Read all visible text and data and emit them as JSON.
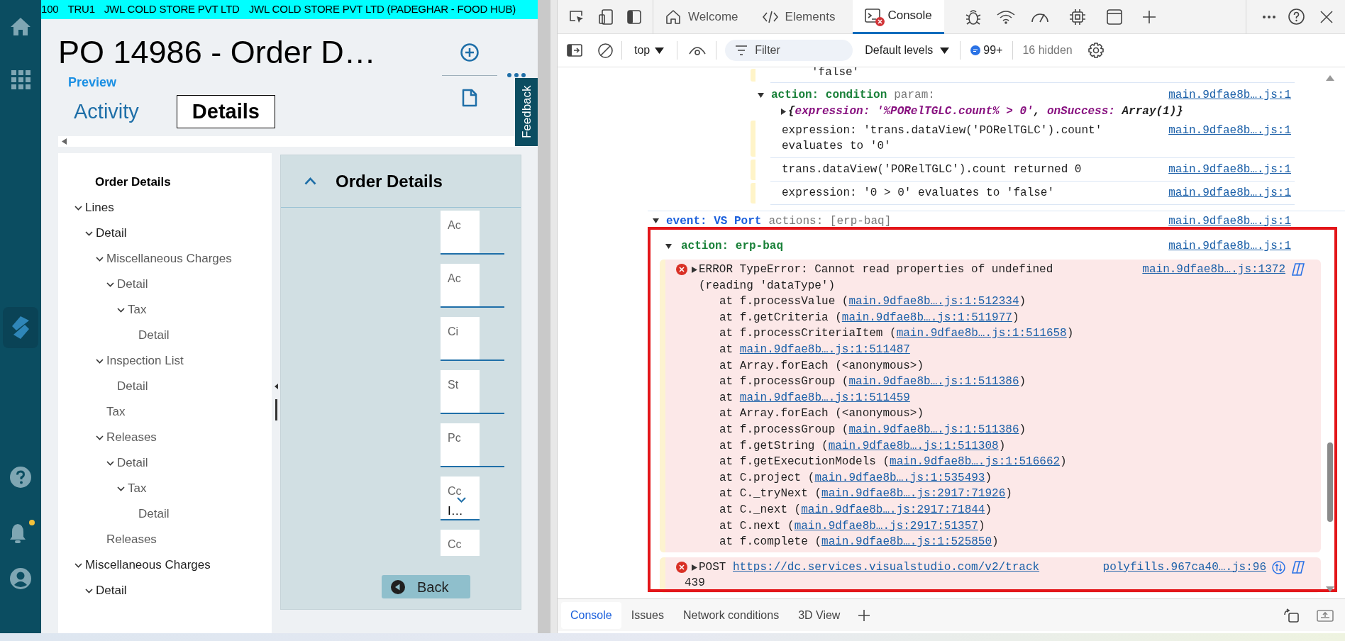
{
  "app": {
    "context_bar": [
      "100",
      "TRU1",
      "JWL COLD STORE PVT LTD",
      "JWL COLD STORE PVT LTD (PADEGHAR - FOOD HUB)"
    ],
    "title": "PO 14986 - Order D…",
    "preview_link": "Preview",
    "tabs": [
      {
        "label": "Activity",
        "selected": false
      },
      {
        "label": "Details",
        "selected": true
      }
    ],
    "feedback_tab": "Feedback",
    "notifications_unread": true,
    "tree": {
      "heading": "Order Details",
      "items": [
        {
          "label": "Lines",
          "expanded": true,
          "children": [
            {
              "label": "Detail",
              "expanded": true,
              "children": [
                {
                  "label": "Miscellaneous Charges",
                  "expanded": true,
                  "children": [
                    {
                      "label": "Detail",
                      "expanded": true,
                      "children": [
                        {
                          "label": "Tax",
                          "expanded": true,
                          "children": [
                            {
                              "label": "Detail"
                            }
                          ]
                        }
                      ]
                    }
                  ]
                },
                {
                  "label": "Inspection List",
                  "expanded": true,
                  "children": [
                    {
                      "label": "Detail"
                    }
                  ]
                },
                {
                  "label": "Tax"
                },
                {
                  "label": "Releases",
                  "expanded": true,
                  "children": [
                    {
                      "label": "Detail",
                      "expanded": true,
                      "children": [
                        {
                          "label": "Tax",
                          "expanded": true,
                          "children": [
                            {
                              "label": "Detail"
                            }
                          ]
                        }
                      ]
                    }
                  ]
                },
                {
                  "label": "Releases"
                }
              ]
            }
          ]
        },
        {
          "label": "Miscellaneous Charges",
          "expanded": true,
          "children": [
            {
              "label": "Detail",
              "expanded": true
            }
          ]
        }
      ]
    },
    "panel": {
      "title": "Order Details",
      "expanded": true,
      "fields": [
        {
          "kind": "text",
          "label": "Ac"
        },
        {
          "kind": "text",
          "label": "Ac"
        },
        {
          "kind": "text",
          "label": "Ci"
        },
        {
          "kind": "text",
          "label": "St"
        },
        {
          "kind": "text",
          "label": "Pc"
        },
        {
          "kind": "dropdown",
          "label": "Cc",
          "value": "I…"
        },
        {
          "kind": "text",
          "label": "Cc"
        }
      ]
    },
    "back_button": "Back"
  },
  "devtools": {
    "tabs": [
      {
        "label": "Welcome",
        "selected": false,
        "error_badge": false
      },
      {
        "label": "Elements",
        "selected": false,
        "error_badge": false
      },
      {
        "label": "Console",
        "selected": true,
        "error_badge": true
      }
    ],
    "toolbar": {
      "context": "top",
      "filter_placeholder": "Filter",
      "levels": "Default levels",
      "message_count": "99+",
      "hidden": "16 hidden"
    },
    "console": {
      "tail_entries": [
        {
          "kind": "log-tail",
          "text": "'false'"
        },
        {
          "kind": "group",
          "expanded": true,
          "label": "action: condition",
          "detail": "param:",
          "source": "main.9dfae8b….js:1",
          "object": {
            "expanded": false,
            "parts": [
              {
                "kind": "plain",
                "text": "{"
              },
              {
                "kind": "key",
                "text": "expression: '%PORelTGLC.count% > 0'"
              },
              {
                "kind": "plain",
                "text": ", "
              },
              {
                "kind": "key",
                "text": "onSuccess:"
              },
              {
                "kind": "plain",
                "text": " Array(1)}"
              }
            ]
          },
          "children": [
            {
              "kind": "log",
              "text": "expression: 'trans.dataView('PORelTGLC').count' evaluates to '0'",
              "source": "main.9dfae8b….js:1"
            },
            {
              "kind": "log",
              "text": "trans.dataView('PORelTGLC').count returned 0",
              "source": "main.9dfae8b….js:1"
            },
            {
              "kind": "log",
              "text": "expression: '0 > 0' evaluates to 'false'",
              "source": "main.9dfae8b….js:1"
            }
          ]
        }
      ],
      "entries": [
        {
          "kind": "event",
          "expanded": true,
          "label": "event: VS Port",
          "detail": "actions: [erp-baq]",
          "source": "main.9dfae8b….js:1",
          "children": [
            {
              "kind": "group",
              "expanded": true,
              "label": "action: erp-baq",
              "source": "main.9dfae8b….js:1",
              "children": [
                {
                  "kind": "error",
                  "message": "ERROR TypeError: Cannot read properties of undefined (reading 'dataType')",
                  "source": "main.9dfae8b….js:1372",
                  "frames": [
                    {
                      "text": "at f.processValue (",
                      "link": "main.9dfae8b….js:1:512334",
                      "tail": ")"
                    },
                    {
                      "text": "at f.getCriteria (",
                      "link": "main.9dfae8b….js:1:511977",
                      "tail": ")"
                    },
                    {
                      "text": "at f.processCriteriaItem (",
                      "link": "main.9dfae8b….js:1:511658",
                      "tail": ")"
                    },
                    {
                      "text": "at ",
                      "link": "main.9dfae8b….js:1:511487"
                    },
                    {
                      "text": "at Array.forEach (<anonymous>)"
                    },
                    {
                      "text": "at f.processGroup (",
                      "link": "main.9dfae8b….js:1:511386",
                      "tail": ")"
                    },
                    {
                      "text": "at ",
                      "link": "main.9dfae8b….js:1:511459"
                    },
                    {
                      "text": "at Array.forEach (<anonymous>)"
                    },
                    {
                      "text": "at f.processGroup (",
                      "link": "main.9dfae8b….js:1:511386",
                      "tail": ")"
                    },
                    {
                      "text": "at f.getString (",
                      "link": "main.9dfae8b….js:1:511308",
                      "tail": ")"
                    },
                    {
                      "text": "at f.getExecutionModels (",
                      "link": "main.9dfae8b….js:1:516662",
                      "tail": ")"
                    },
                    {
                      "text": "at C.project (",
                      "link": "main.9dfae8b….js:1:535493",
                      "tail": ")"
                    },
                    {
                      "text": "at C._tryNext (",
                      "link": "main.9dfae8b….js:2917:71926",
                      "tail": ")"
                    },
                    {
                      "text": "at C._next (",
                      "link": "main.9dfae8b….js:2917:71844",
                      "tail": ")"
                    },
                    {
                      "text": "at C.next (",
                      "link": "main.9dfae8b….js:2917:51357",
                      "tail": ")"
                    },
                    {
                      "text": "at f.complete (",
                      "link": "main.9dfae8b….js:1:525850",
                      "tail": ")"
                    }
                  ]
                },
                {
                  "kind": "network-error",
                  "method": "POST",
                  "url": "https://dc.services.visualstudio.com/v2/track",
                  "status": "439",
                  "source": "polyfills.967ca40….js:96"
                }
              ]
            }
          ]
        }
      ]
    },
    "drawer_tabs": [
      {
        "label": "Console",
        "selected": true
      },
      {
        "label": "Issues",
        "selected": false
      },
      {
        "label": "Network conditions",
        "selected": false
      },
      {
        "label": "3D View",
        "selected": false
      }
    ]
  }
}
